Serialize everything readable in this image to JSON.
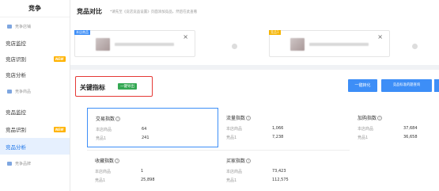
{
  "sidebar": {
    "title": "竞争",
    "items": [
      {
        "type": "sub",
        "label": "竞争店铺"
      },
      {
        "type": "item",
        "label": "竞店监控"
      },
      {
        "type": "item",
        "label": "竞店识别",
        "badge": "NEW"
      },
      {
        "type": "item",
        "label": "竞店分析"
      },
      {
        "type": "sub",
        "label": "竞争商品"
      },
      {
        "type": "item",
        "label": "竞品监控"
      },
      {
        "type": "item",
        "label": "竞品识别",
        "badge": "NEW"
      },
      {
        "type": "item",
        "label": "竞品分析",
        "active": true
      },
      {
        "type": "sub",
        "label": "竞争品牌"
      }
    ]
  },
  "header": {
    "title": "竞品对比",
    "hint": "*请先至《竞店竞品设置》页面添加竞品，然后在此查看"
  },
  "compare": {
    "product_a": {
      "tag": "本店商品",
      "tag_color": "#3d8ef7"
    },
    "product_b": {
      "tag": "竞品1",
      "tag_color": "#f5b400"
    }
  },
  "metrics": {
    "title": "关键指标",
    "export_label": "一键导出",
    "convert_label": "一键转化",
    "query_label": "竞品标准的题查询",
    "cards": [
      {
        "name": "交易指数",
        "rows": [
          {
            "label": "本店商品",
            "value": "64"
          },
          {
            "label": "竞品1",
            "value": "241"
          }
        ],
        "active": true
      },
      {
        "name": "流量指数",
        "rows": [
          {
            "label": "本店商品",
            "value": "1,066"
          },
          {
            "label": "竞品1",
            "value": "7,238"
          }
        ]
      },
      {
        "name": "加购指数",
        "rows": [
          {
            "label": "本店商品",
            "value": "37,684"
          },
          {
            "label": "竞品1",
            "value": "36,658"
          }
        ]
      },
      {
        "name": "收藏指数",
        "rows": [
          {
            "label": "本店商品",
            "value": "1"
          },
          {
            "label": "竞品1",
            "value": "25,898"
          }
        ]
      },
      {
        "name": "买家指数",
        "rows": [
          {
            "label": "本店商品",
            "value": "73,423"
          },
          {
            "label": "竞品1",
            "value": "112,575"
          }
        ]
      }
    ]
  },
  "colors": {
    "accent": "#3d8ef7",
    "export_green": "#34a853",
    "highlight_red": "#e53935",
    "new_badge": "#ffb300",
    "active_bg": "#e6f0fe"
  }
}
